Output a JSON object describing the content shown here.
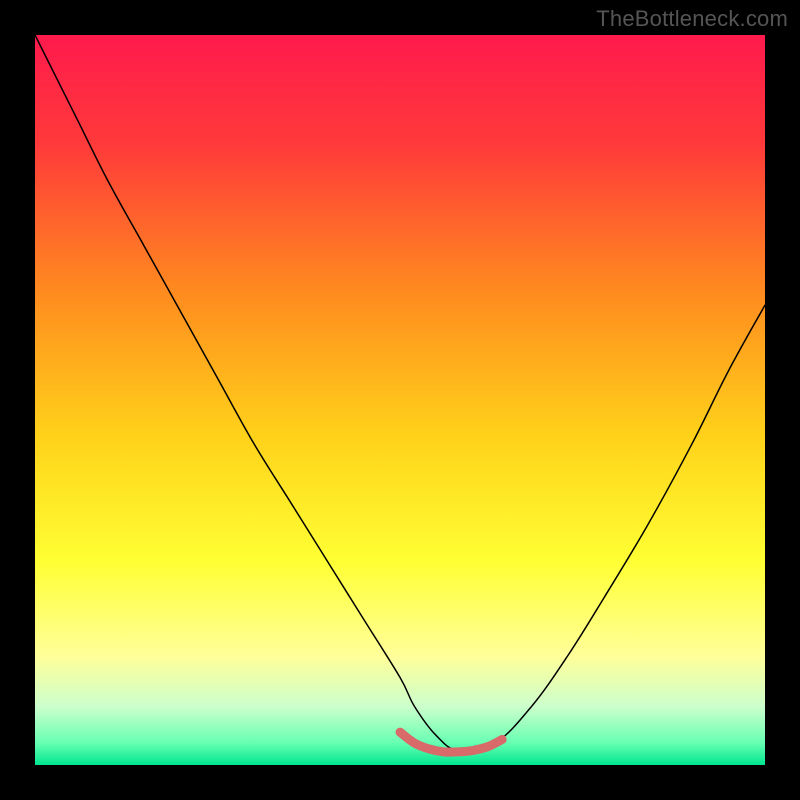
{
  "watermark": "TheBottleneck.com",
  "chart_data": {
    "type": "line",
    "title": "",
    "xlabel": "",
    "ylabel": "",
    "xlim": [
      0,
      100
    ],
    "ylim": [
      0,
      100
    ],
    "grid": false,
    "legend": false,
    "background_gradient": {
      "stops": [
        {
          "pos": 0.0,
          "color": "#ff1a4d"
        },
        {
          "pos": 0.15,
          "color": "#ff3a3a"
        },
        {
          "pos": 0.35,
          "color": "#ff8a1f"
        },
        {
          "pos": 0.55,
          "color": "#ffd21a"
        },
        {
          "pos": 0.72,
          "color": "#ffff33"
        },
        {
          "pos": 0.85,
          "color": "#ffff99"
        },
        {
          "pos": 0.92,
          "color": "#ccffcc"
        },
        {
          "pos": 0.97,
          "color": "#66ffb2"
        },
        {
          "pos": 1.0,
          "color": "#00e58f"
        }
      ]
    },
    "series": [
      {
        "name": "bottleneck-curve-black",
        "stroke": "#000000",
        "stroke_width": 1.5,
        "x": [
          0.0,
          3.0,
          6.0,
          10.0,
          15.0,
          20.0,
          25.0,
          30.0,
          35.0,
          40.0,
          45.0,
          50.0,
          52.0,
          55.0,
          58.0,
          63.0,
          68.0,
          73.0,
          78.0,
          84.0,
          90.0,
          95.0,
          100.0
        ],
        "y": [
          100.0,
          94.0,
          88.0,
          80.0,
          71.0,
          62.0,
          53.0,
          44.0,
          36.0,
          28.0,
          20.0,
          12.0,
          8.0,
          4.0,
          2.0,
          3.0,
          8.0,
          15.0,
          23.0,
          33.0,
          44.0,
          54.0,
          63.0
        ]
      },
      {
        "name": "trough-highlight-red",
        "stroke": "#d86a6a",
        "stroke_width": 9,
        "x": [
          50.0,
          52.0,
          54.0,
          56.0,
          58.0,
          60.0,
          62.0,
          64.0
        ],
        "y": [
          4.5,
          3.0,
          2.2,
          1.8,
          1.8,
          2.0,
          2.5,
          3.5
        ]
      }
    ]
  }
}
